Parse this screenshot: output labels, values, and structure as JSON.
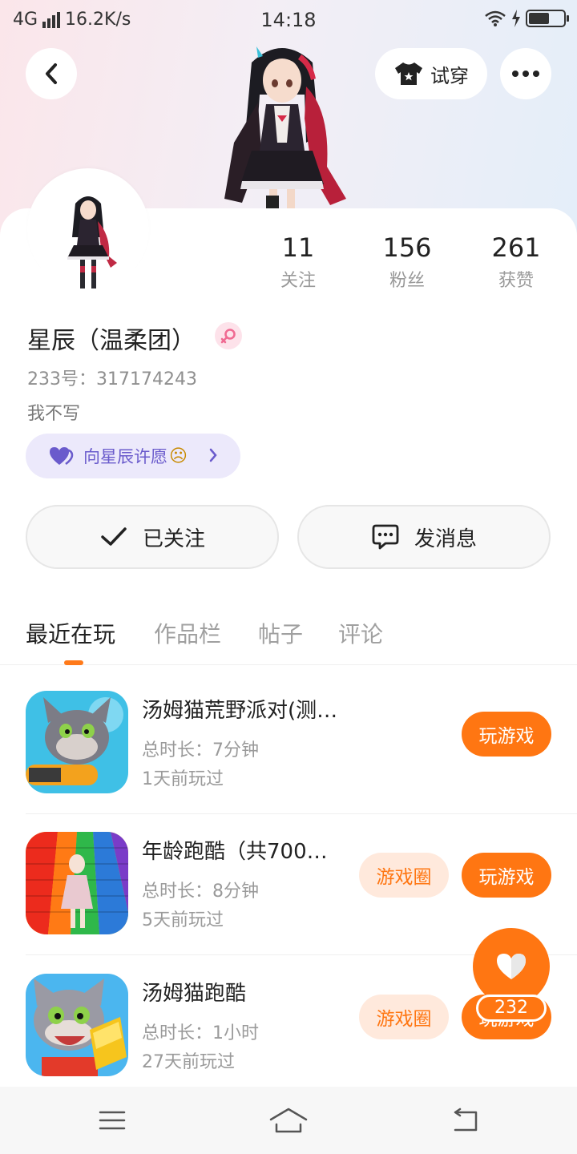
{
  "status_bar": {
    "network": "4G",
    "speed": "16.2K/s",
    "time": "14:18"
  },
  "header": {
    "try_on_label": "试穿"
  },
  "profile": {
    "name": "星辰（温柔团）",
    "gender": "female",
    "uid_label": "233号：317174243",
    "bio": "我不写",
    "wish_label": "向星辰许愿",
    "wish_emoji": "☹",
    "stats": [
      {
        "value": "11",
        "label": "关注"
      },
      {
        "value": "156",
        "label": "粉丝"
      },
      {
        "value": "261",
        "label": "获赞"
      }
    ]
  },
  "actions": {
    "follow_label": "已关注",
    "message_label": "发消息"
  },
  "tabs": [
    "最近在玩",
    "作品栏",
    "帖子",
    "评论"
  ],
  "active_tab": "最近在玩",
  "games": [
    {
      "title": "汤姆猫荒野派对(测试服)",
      "duration": "总时长：7分钟",
      "last_played": "1天前玩过",
      "circle_label": "",
      "play_label": "玩游戏"
    },
    {
      "title": "年龄跑酷（共700…",
      "duration": "总时长：8分钟",
      "last_played": "5天前玩过",
      "circle_label": "游戏圈",
      "play_label": "玩游戏"
    },
    {
      "title": "汤姆猫跑酷",
      "duration": "总时长：1小时",
      "last_played": "27天前玩过",
      "circle_label": "游戏圈",
      "play_label": "玩游戏"
    }
  ],
  "like": {
    "count": "232"
  },
  "colors": {
    "accent": "#ff7612",
    "wish_bg": "#ece9fb",
    "wish_text": "#6a5bcc"
  },
  "icons": {
    "back": "chevron-left-icon",
    "try_on": "tshirt-icon",
    "more": "more-dots-icon",
    "follow": "check-icon",
    "message": "chat-bubble-icon",
    "wish": "heart-icon",
    "like": "heart-icon"
  }
}
